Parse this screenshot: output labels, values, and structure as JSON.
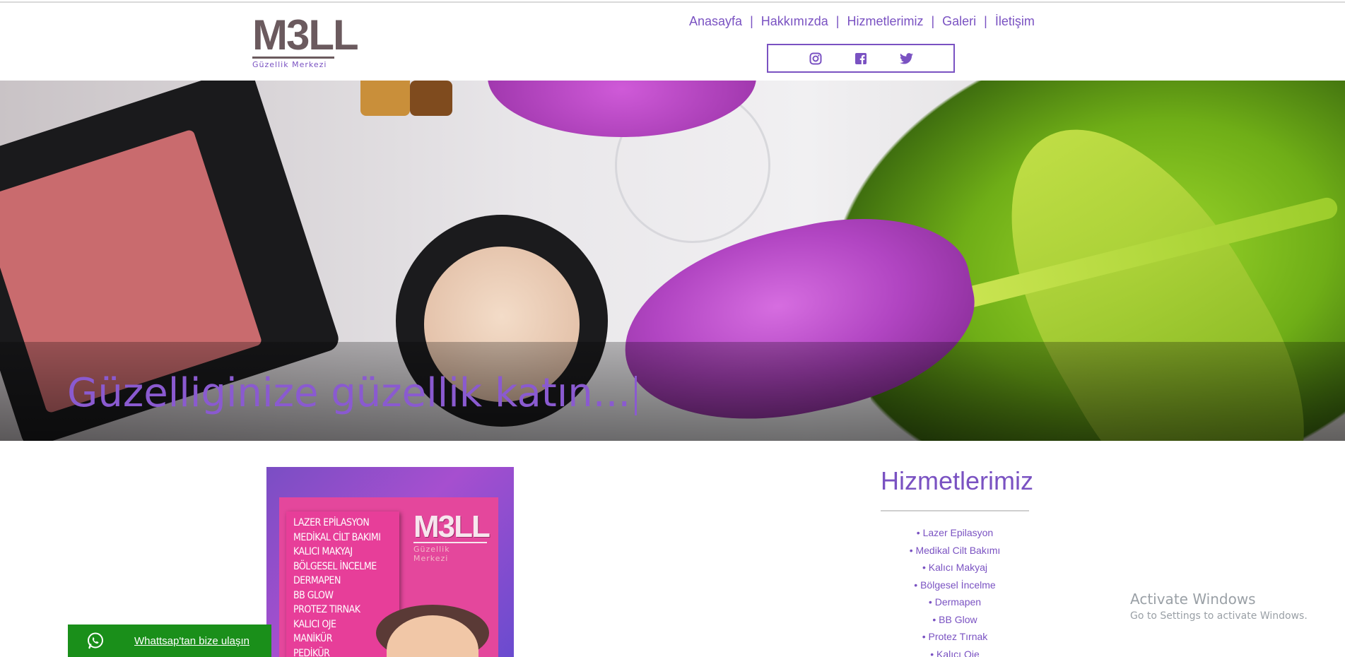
{
  "brand": {
    "logo_text": "M3LL",
    "logo_subtitle": "Güzellik Merkezi",
    "accent_color": "#7a52c2"
  },
  "nav": {
    "items": [
      {
        "label": "Anasayfa"
      },
      {
        "label": "Hakkımızda"
      },
      {
        "label": "Hizmetlerimiz"
      },
      {
        "label": "Galeri"
      },
      {
        "label": "İletişim"
      }
    ],
    "separator": "|"
  },
  "social": {
    "icons": [
      "instagram-icon",
      "facebook-icon",
      "twitter-icon"
    ]
  },
  "hero": {
    "tagline": "Güzelliginize güzellik katın..."
  },
  "flyer": {
    "logo_text": "M3LL",
    "logo_subtitle": "Güzellik Merkezi",
    "items": [
      "LAZER EPİLASYON",
      "MEDİKAL CİLT BAKIMI",
      "KALICI MAKYAJ",
      "BÖLGESEL İNCELME",
      "DERMAPEN",
      "BB GLOW",
      "PROTEZ TIRNAK",
      "KALICI OJE",
      "MANİKÜR",
      "PEDİKÜR"
    ]
  },
  "services": {
    "title": "Hizmetlerimiz",
    "items": [
      "• Lazer Epilasyon",
      "• Medikal Cilt Bakımı",
      "• Kalıcı Makyaj",
      "• Bölgesel İncelme",
      "• Dermapen",
      "• BB Glow",
      "• Protez Tırnak",
      "• Kalıcı Oje"
    ]
  },
  "whatsapp": {
    "label": "Whattsap'tan bize ulaşın",
    "color": "#1a8f1a"
  },
  "windows_watermark": {
    "title": "Activate Windows",
    "subtitle": "Go to Settings to activate Windows."
  }
}
